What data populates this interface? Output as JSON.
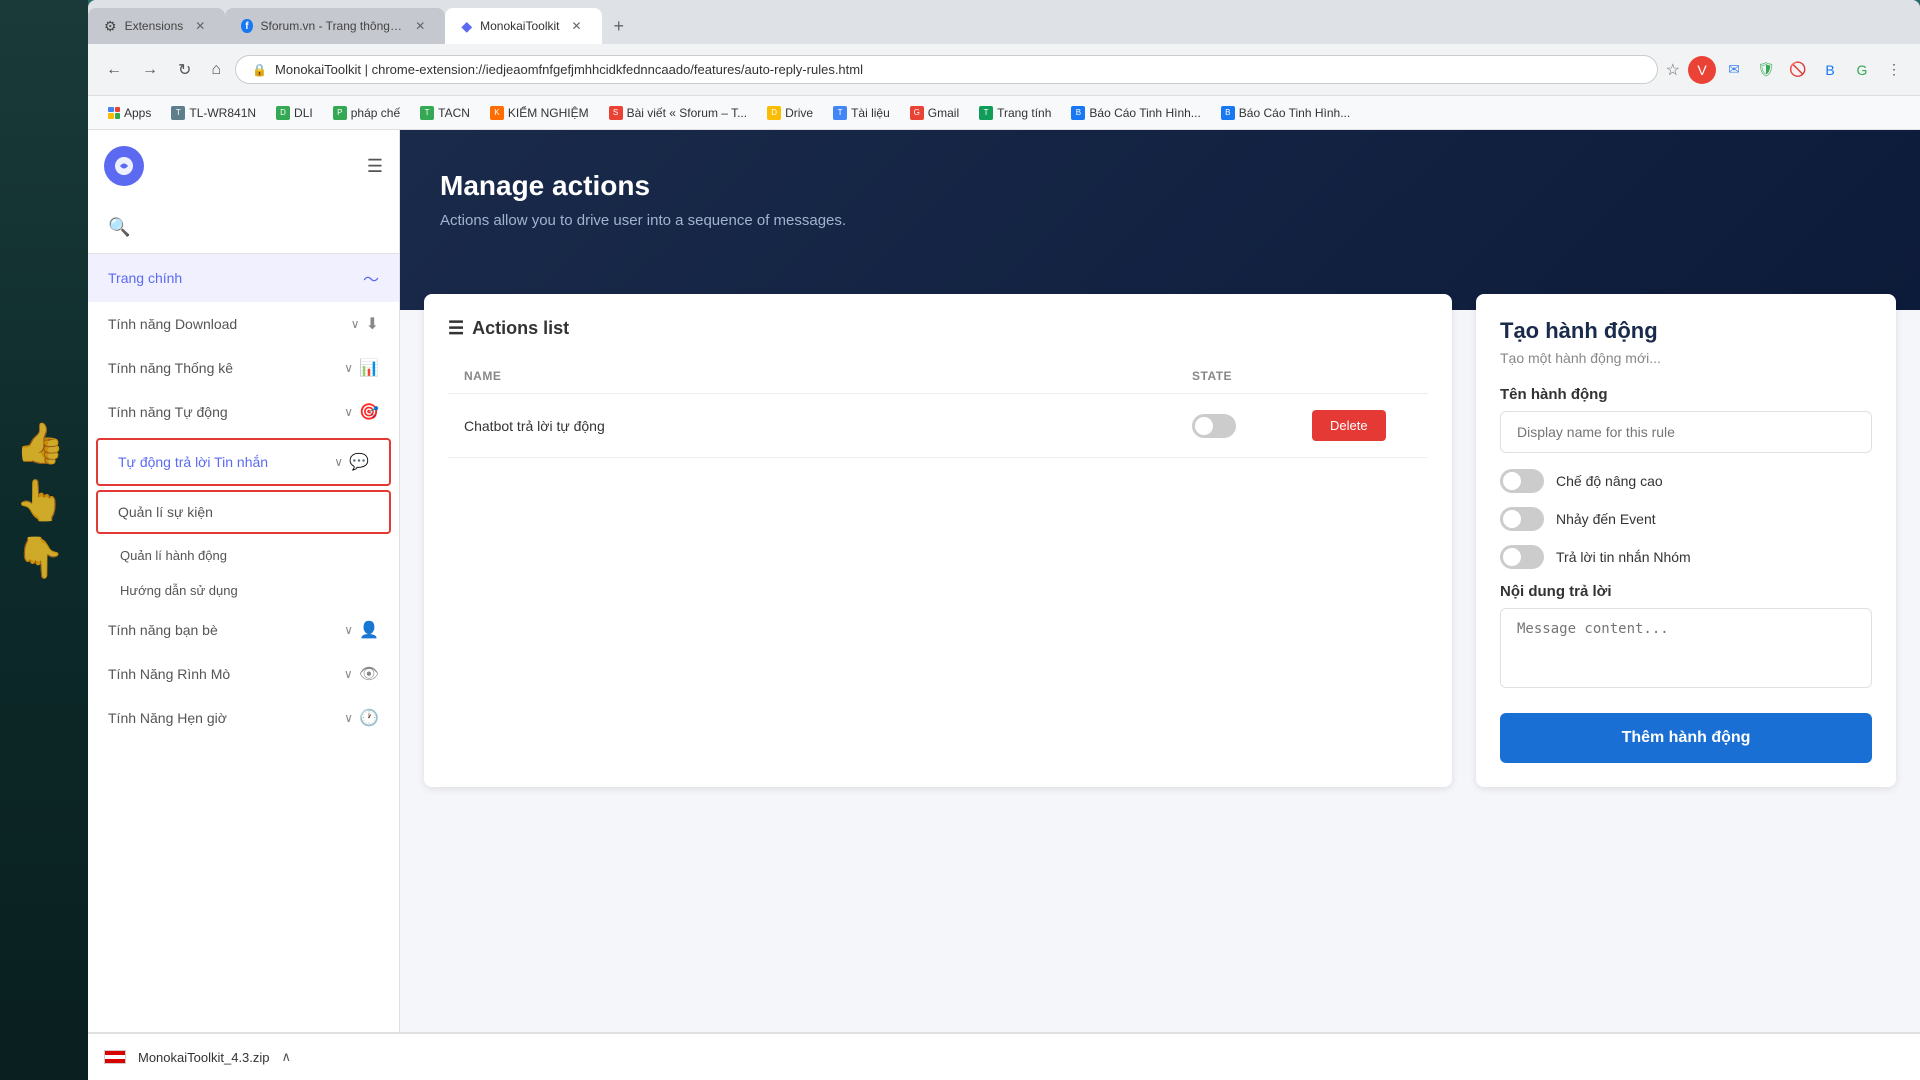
{
  "browser": {
    "tabs": [
      {
        "id": "extensions",
        "label": "Extensions",
        "icon": "⚙",
        "active": false
      },
      {
        "id": "sforum",
        "label": "Sforum.vn - Trang thông tin côn...",
        "icon": "f",
        "active": false
      },
      {
        "id": "monokai",
        "label": "MonokaiToolkit",
        "icon": "◆",
        "active": true
      }
    ],
    "url": "MonokaiToolkit  |  chrome-extension://iedjeaomfnfgefjmhhcidkfednncaado/features/auto-reply-rules.html",
    "new_tab_label": "+"
  },
  "bookmarks": [
    {
      "id": "apps",
      "label": "Apps",
      "color": "#4285f4"
    },
    {
      "id": "tl",
      "label": "TL-WR841N",
      "color": "#888"
    },
    {
      "id": "dli",
      "label": "DLI",
      "color": "#34a853"
    },
    {
      "id": "phapche",
      "label": "pháp chế",
      "color": "#34a853"
    },
    {
      "id": "tacn",
      "label": "TACN",
      "color": "#34a853"
    },
    {
      "id": "kiemnghiem",
      "label": "KIỂM NGHIỆM",
      "color": "#ff6d00"
    },
    {
      "id": "baiviet",
      "label": "Bài viết « Sforum – T...",
      "color": "#ea4335"
    },
    {
      "id": "drive",
      "label": "Drive",
      "color": "#fbbc04"
    },
    {
      "id": "tailieu",
      "label": "Tài liệu",
      "color": "#4285f4"
    },
    {
      "id": "gmail",
      "label": "Gmail",
      "color": "#ea4335"
    },
    {
      "id": "trangtinh",
      "label": "Trang tính",
      "color": "#0f9d58"
    },
    {
      "id": "baocao1",
      "label": "Báo Cáo Tinh Hình...",
      "color": "#1877f2"
    },
    {
      "id": "baocao2",
      "label": "Báo Cáo Tinh Hình...",
      "color": "#1877f2"
    }
  ],
  "sidebar": {
    "items": [
      {
        "id": "trang-chinh",
        "label": "Trang chính",
        "icon": "📈",
        "active": true,
        "hasArrow": false
      },
      {
        "id": "download",
        "label": "Tính năng Download",
        "icon": "⬇",
        "hasArrow": true
      },
      {
        "id": "thongke",
        "label": "Tính năng Thống kê",
        "icon": "📊",
        "hasArrow": true
      },
      {
        "id": "tudong",
        "label": "Tính năng Tự động",
        "icon": "🎯",
        "hasArrow": true
      },
      {
        "id": "tuloi",
        "label": "Tự động trả lời Tin nhắn",
        "icon": "💬",
        "hasArrow": true,
        "highlighted": true
      },
      {
        "id": "quanli",
        "label": "Quản lí sự kiện",
        "icon": "",
        "hasArrow": false,
        "highlighted": true
      },
      {
        "id": "quanli-hd",
        "label": "Quản lí hành động",
        "icon": "",
        "hasArrow": false,
        "sub": true
      },
      {
        "id": "huongdan",
        "label": "Hướng dẫn sử dụng",
        "icon": "",
        "hasArrow": false,
        "sub": true
      },
      {
        "id": "banbe",
        "label": "Tính năng bạn bè",
        "icon": "👤",
        "hasArrow": true
      },
      {
        "id": "rinmo",
        "label": "Tính Năng Rình Mò",
        "icon": "👁",
        "hasArrow": true
      },
      {
        "id": "hengio",
        "label": "Tính Năng Hẹn giờ",
        "icon": "🕐",
        "hasArrow": true
      }
    ]
  },
  "search": {
    "placeholder": "🔍"
  },
  "hero": {
    "title": "Manage actions",
    "subtitle": "Actions allow you to drive user into a sequence of messages."
  },
  "actions_list": {
    "title": "Actions list",
    "columns": [
      "NAME",
      "STATE",
      ""
    ],
    "rows": [
      {
        "name": "Chatbot trả lời tự động",
        "state": "off",
        "delete_label": "Delete"
      }
    ]
  },
  "create_panel": {
    "title": "Tạo hành động",
    "subtitle": "Tạo một hành động mới...",
    "name_label": "Tên hành động",
    "name_placeholder": "Display name for this rule",
    "toggle1_label": "Chế độ nâng cao",
    "toggle2_label": "Nhảy đến Event",
    "toggle3_label": "Trả lời tin nhắn Nhóm",
    "content_label": "Nội dung trả lời",
    "content_placeholder": "Message content...",
    "add_btn_label": "Thêm hành động"
  },
  "status_bar": {
    "url": "chrome-extension://iedjeaomfnfgefjmhhcidkfednncaado/features/auto-reply-events.html"
  },
  "download_bar": {
    "filename": "MonokaiToolkit_4.3.zip",
    "chevron": "∧"
  }
}
